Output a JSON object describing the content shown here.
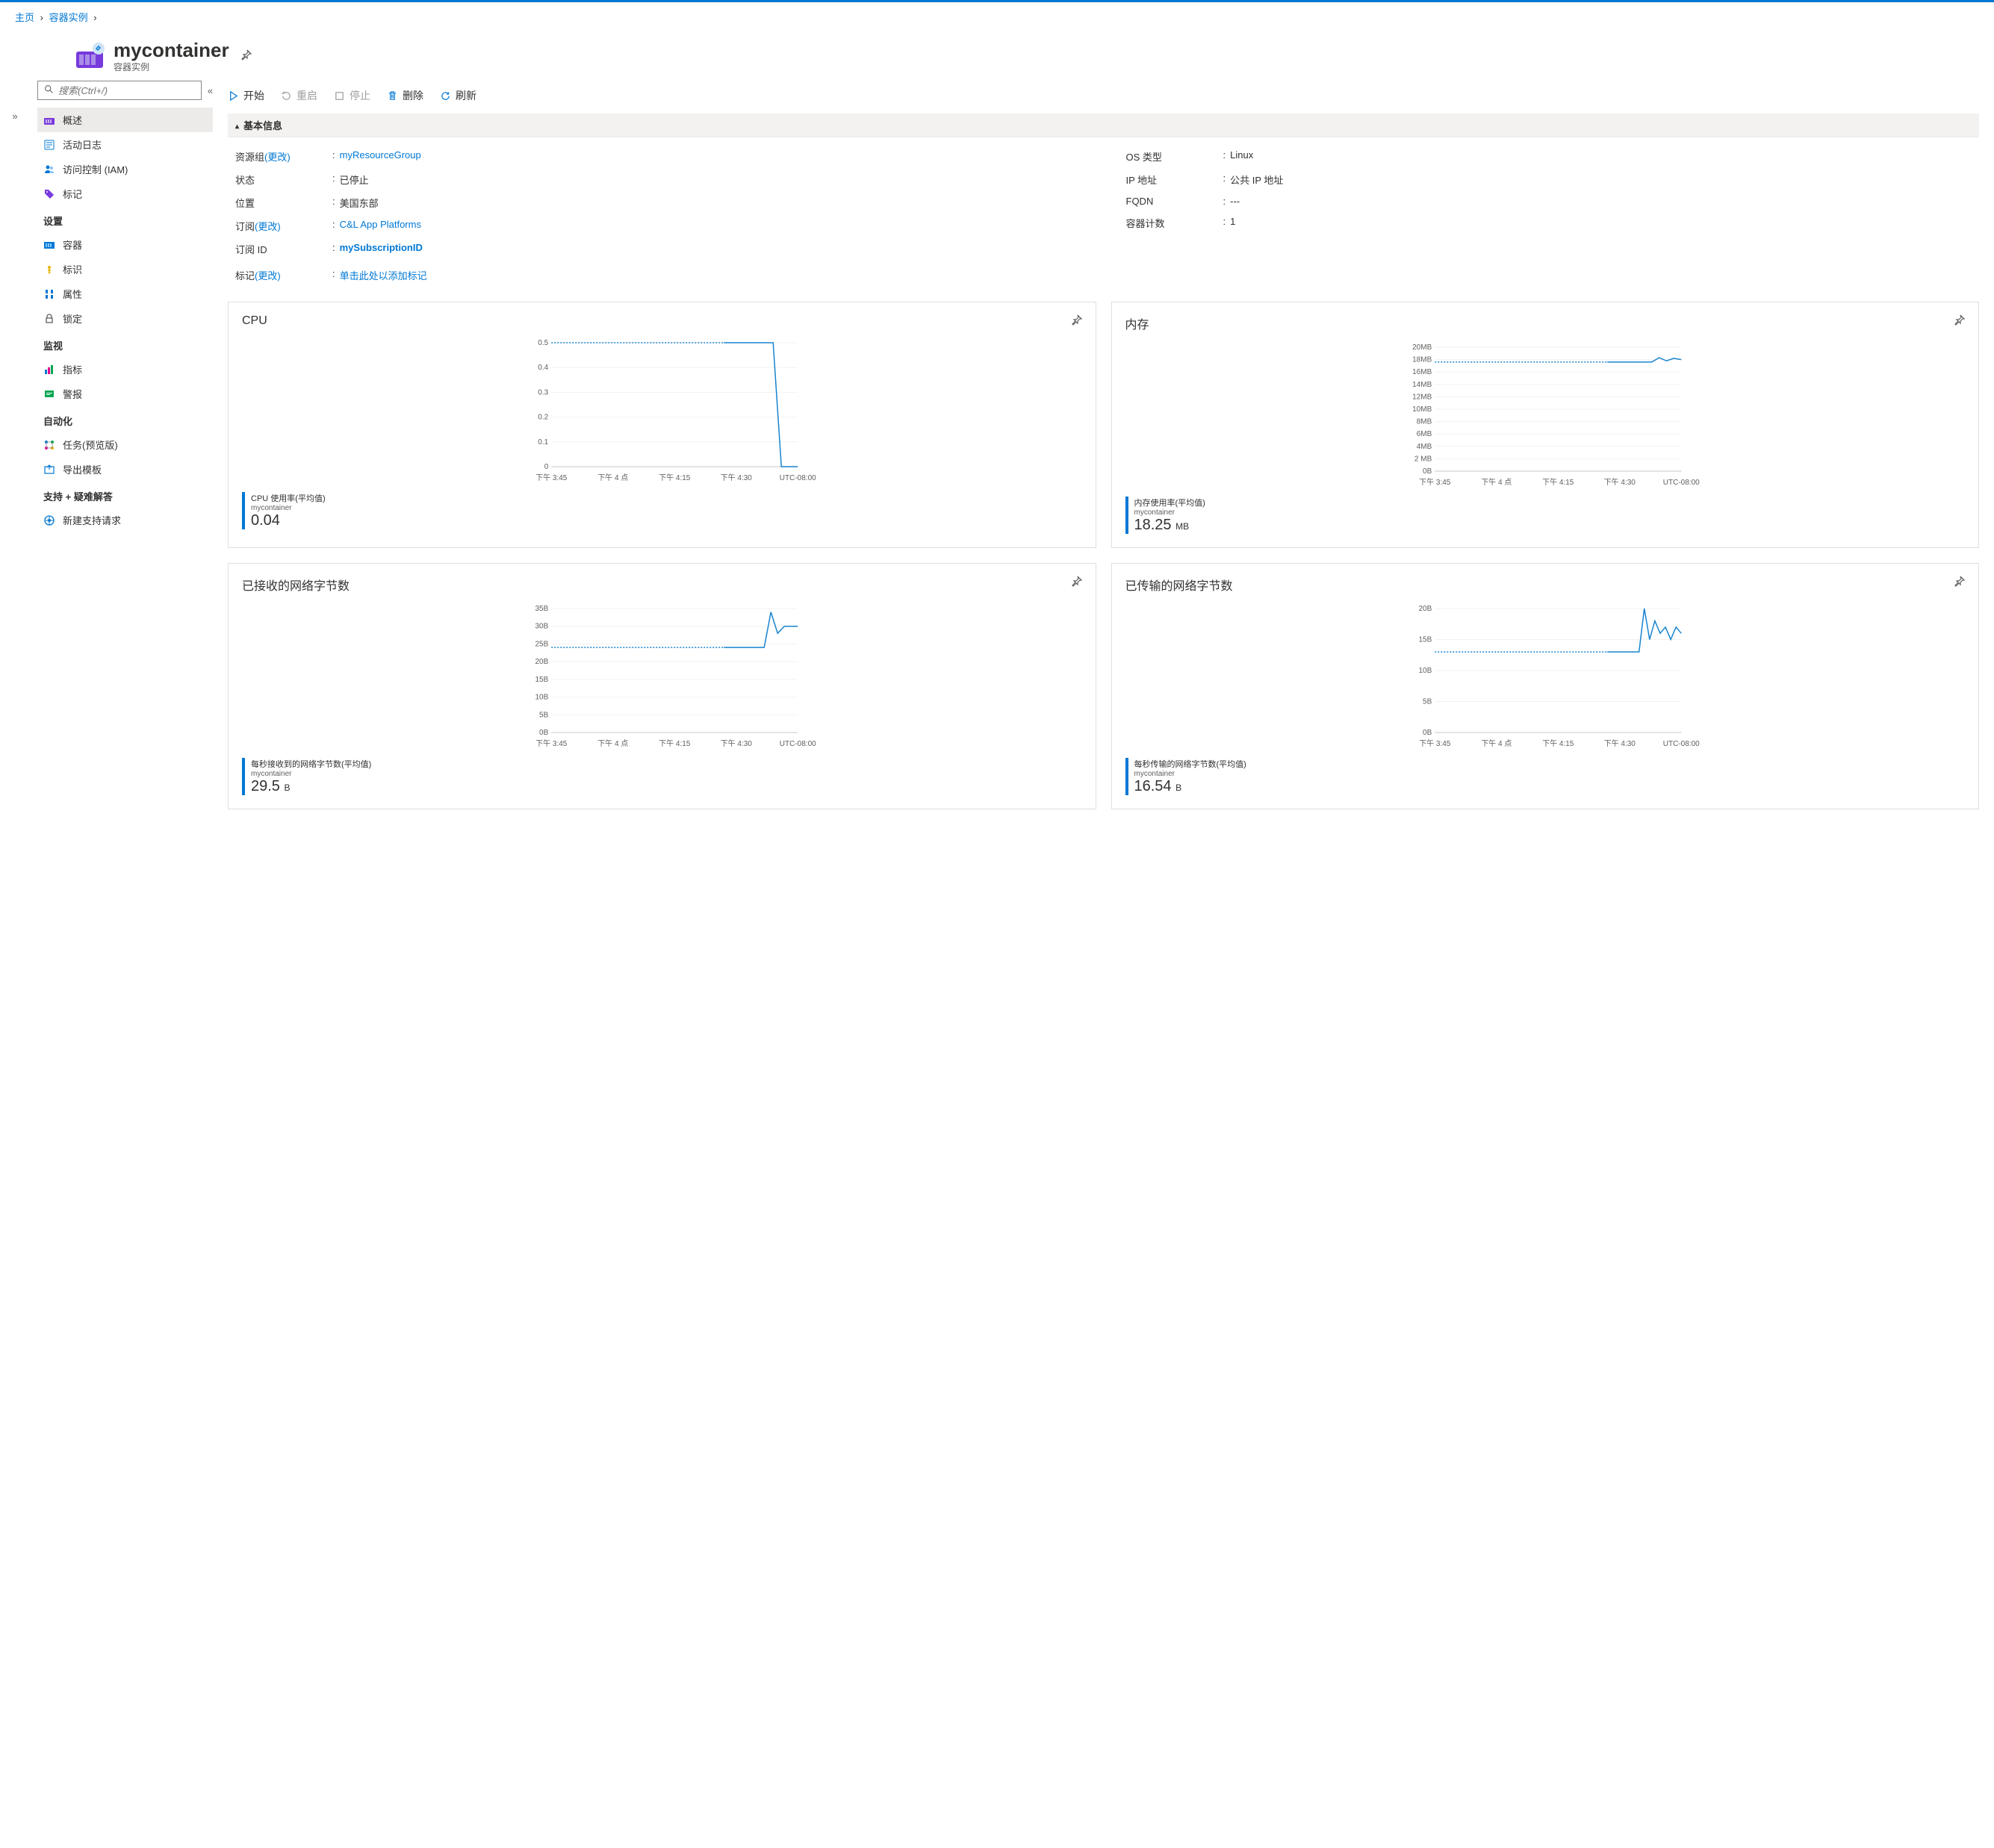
{
  "breadcrumb": {
    "home": "主页",
    "section": "容器实例"
  },
  "header": {
    "title": "mycontainer",
    "subtitle": "容器实例"
  },
  "search": {
    "placeholder": "搜索(Ctrl+/)"
  },
  "nav": {
    "top": [
      {
        "label": "概述",
        "icon": "overview"
      },
      {
        "label": "活动日志",
        "icon": "log"
      },
      {
        "label": "访问控制 (IAM)",
        "icon": "iam"
      },
      {
        "label": "标记",
        "icon": "tag"
      }
    ],
    "settings_title": "设置",
    "settings": [
      {
        "label": "容器",
        "icon": "container"
      },
      {
        "label": "标识",
        "icon": "identity"
      },
      {
        "label": "属性",
        "icon": "props"
      },
      {
        "label": "锁定",
        "icon": "lock"
      }
    ],
    "monitor_title": "监视",
    "monitor": [
      {
        "label": "指标",
        "icon": "metrics"
      },
      {
        "label": "警报",
        "icon": "alerts"
      }
    ],
    "automation_title": "自动化",
    "automation": [
      {
        "label": "任务(预览版)",
        "icon": "tasks"
      },
      {
        "label": "导出模板",
        "icon": "export"
      }
    ],
    "support_title": "支持 + 疑难解答",
    "support": [
      {
        "label": "新建支持请求",
        "icon": "support"
      }
    ]
  },
  "toolbar": {
    "start": "开始",
    "restart": "重启",
    "stop": "停止",
    "delete": "删除",
    "refresh": "刷新"
  },
  "essentials": {
    "title": "基本信息",
    "left": [
      {
        "label": "资源组",
        "change": "(更改)",
        "value": "myResourceGroup",
        "link": true
      },
      {
        "label": "状态",
        "value": "已停止"
      },
      {
        "label": "位置",
        "value": "美国东部"
      },
      {
        "label": "订阅",
        "change": "(更改)",
        "value": "C&L App Platforms",
        "link": true
      },
      {
        "label": "订阅 ID",
        "value": "mySubscriptionID",
        "link": true,
        "bold": true
      }
    ],
    "right": [
      {
        "label": "OS 类型",
        "value": "Linux"
      },
      {
        "label": "IP 地址",
        "value": "公共 IP 地址"
      },
      {
        "label": "FQDN",
        "value": "---"
      },
      {
        "label": "容器计数",
        "value": "1"
      }
    ],
    "tags": {
      "label": "标记",
      "change": "(更改)",
      "value": "单击此处以添加标记"
    }
  },
  "chart_data": [
    {
      "title": "CPU",
      "type": "line",
      "ylim": [
        0,
        0.5
      ],
      "yticks": [
        "0",
        "0.1",
        "0.2",
        "0.3",
        "0.4",
        "0.5"
      ],
      "xticks": [
        "下午 3:45",
        "下午 4 点",
        "下午 4:15",
        "下午 4:30",
        "UTC-08:00"
      ],
      "series": [
        {
          "name": "cpu",
          "values": [
            0.5,
            0.5,
            0.5,
            0.5,
            0.5,
            0.5,
            0.5,
            0.0,
            0.0,
            0.0
          ]
        }
      ],
      "avg_line": 0.5,
      "metric_name": "CPU 使用率(平均值)",
      "resource": "mycontainer",
      "value": "0.04"
    },
    {
      "title": "内存",
      "type": "line",
      "ylim": [
        0,
        20
      ],
      "yticks": [
        "0B",
        "2 MB",
        "4MB",
        "6MB",
        "8MB",
        "10MB",
        "12MB",
        "14MB",
        "16MB",
        "18MB",
        "20MB"
      ],
      "xticks": [
        "下午 3:45",
        "下午 4 点",
        "下午 4:15",
        "下午 4:30",
        "UTC-08:00"
      ],
      "series": [
        {
          "name": "mem",
          "values": [
            17.6,
            17.6,
            17.6,
            17.6,
            17.6,
            17.6,
            17.6,
            18.3,
            17.8,
            18.2,
            18.0
          ]
        }
      ],
      "avg_line": 17.6,
      "metric_name": "内存使用率(平均值)",
      "resource": "mycontainer",
      "value": "18.25",
      "unit": "MB"
    },
    {
      "title": "已接收的网络字节数",
      "type": "line",
      "ylim": [
        0,
        35
      ],
      "yticks": [
        "0B",
        "5B",
        "10B",
        "15B",
        "20B",
        "25B",
        "30B",
        "35B"
      ],
      "xticks": [
        "下午 3:45",
        "下午 4 点",
        "下午 4:15",
        "下午 4:30",
        "UTC-08:00"
      ],
      "series": [
        {
          "name": "rx",
          "values": [
            24,
            24,
            24,
            24,
            24,
            24,
            24,
            34,
            28,
            30,
            30,
            30
          ]
        }
      ],
      "avg_line": 24,
      "metric_name": "每秒接收到的网络字节数(平均值)",
      "resource": "mycontainer",
      "value": "29.5",
      "unit": "B"
    },
    {
      "title": "已传输的网络字节数",
      "type": "line",
      "ylim": [
        0,
        20
      ],
      "yticks": [
        "0B",
        "5B",
        "10B",
        "15B",
        "20B"
      ],
      "xticks": [
        "下午 3:45",
        "下午 4 点",
        "下午 4:15",
        "下午 4:30",
        "UTC-08:00"
      ],
      "series": [
        {
          "name": "tx",
          "values": [
            13,
            13,
            13,
            13,
            13,
            13,
            13,
            20,
            15,
            18,
            16,
            17,
            15,
            17,
            16
          ]
        }
      ],
      "avg_line": 13,
      "metric_name": "每秒传输的网络字节数(平均值)",
      "resource": "mycontainer",
      "value": "16.54",
      "unit": "B"
    }
  ]
}
